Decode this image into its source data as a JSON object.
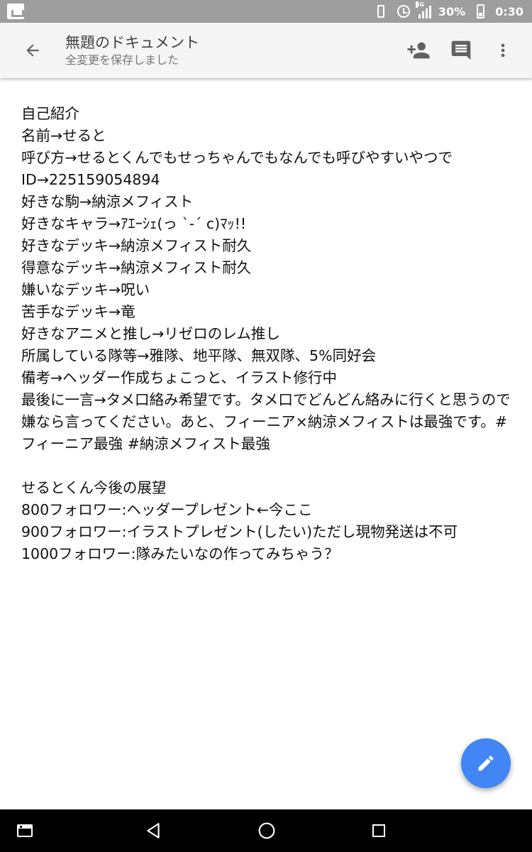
{
  "status_bar": {
    "network_label": "4G",
    "battery_percent": "30%",
    "time": "0:30"
  },
  "app_bar": {
    "title": "無題のドキュメント",
    "subtitle": "全変更を保存しました",
    "icons": [
      "back-arrow-icon",
      "add-person-icon",
      "comment-icon",
      "more-vert-icon"
    ]
  },
  "document": {
    "lines": [
      "自己紹介",
      "名前→せると",
      "呼び方→せるとくんでもせっちゃんでもなんでも呼びやすいやつで",
      "ID→225159054894",
      "好きな駒→納涼メフィスト",
      "好きなキャラ→ｱｴｰｼｪ(っ ˋ-ˊ c)ﾏｯ!!",
      "好きなデッキ→納涼メフィスト耐久",
      "得意なデッキ→納涼メフィスト耐久",
      "嫌いなデッキ→呪い",
      "苦手なデッキ→竜",
      "好きなアニメと推し→リゼロのレム推し",
      "所属している隊等→雅隊、地平隊、無双隊、5%同好会",
      "備考→ヘッダー作成ちょこっと、イラスト修行中",
      "最後に一言→タメ口絡み希望です。タメ口でどんどん絡みに行くと思うので嫌なら言ってください。あと、フィーニア×納涼メフィストは最強です。#フィーニア最強 #納涼メフィスト最強",
      "",
      "せるとくん今後の展望",
      "800フォロワー:ヘッダープレゼント←今ここ",
      "900フォロワー:イラストプレゼント(したい)ただし現物発送は不可",
      "1000フォロワー:隊みたいなの作ってみちゃう？"
    ]
  },
  "fab": {
    "icon": "edit-pencil-icon"
  },
  "nav_bar": {
    "icons": [
      "screenshot-icon",
      "back-triangle-icon",
      "home-circle-icon",
      "recents-square-icon"
    ]
  },
  "colors": {
    "accent": "#4285f4",
    "status_bar": "#9e9e9e",
    "app_bar": "#f5f5f5"
  }
}
